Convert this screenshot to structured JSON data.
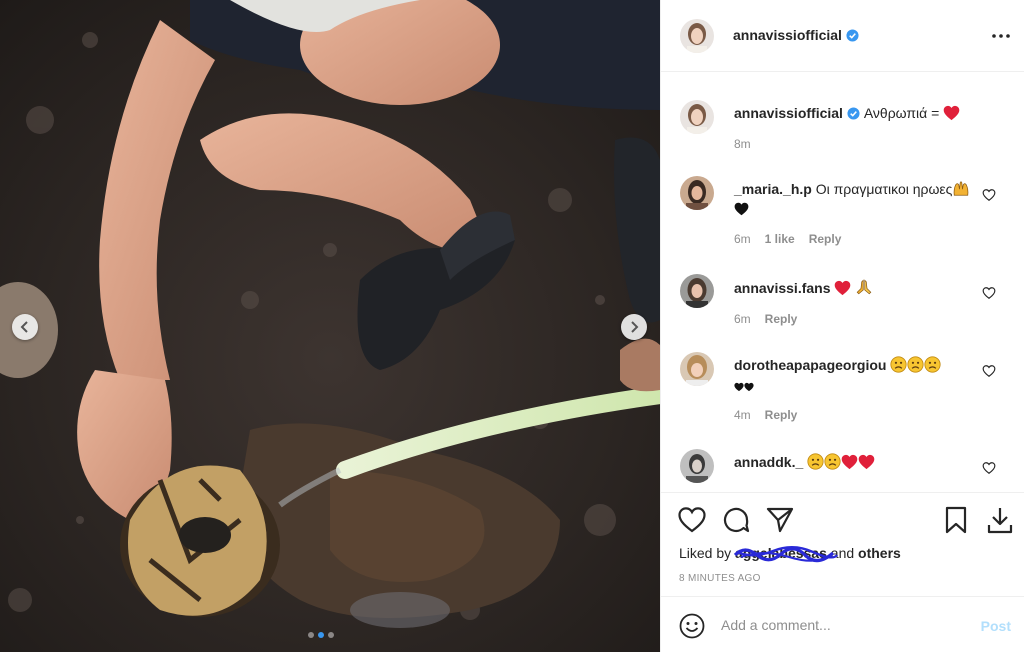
{
  "post": {
    "author": "annavissiofficial",
    "verified": true,
    "more_icon": "more-horizontal-icon"
  },
  "caption": {
    "username": "annavissiofficial",
    "text": "Ανθρωπιά = ",
    "emoji": "red-heart",
    "time": "8m"
  },
  "comments": [
    {
      "username": "_maria._h.p",
      "text": "Οι πραγματικοι ηρωες",
      "emojis": [
        "hands-icon",
        "black-heart"
      ],
      "time": "6m",
      "likes": "1 like",
      "reply": "Reply"
    },
    {
      "username": "annavissi.fans",
      "text": "",
      "emojis": [
        "red-heart",
        "folded-hands"
      ],
      "time": "6m",
      "likes": "",
      "reply": "Reply"
    },
    {
      "username": "dorotheapapageorgiou",
      "text": "",
      "emojis": [
        "sad-face",
        "sad-face",
        "sad-face",
        "black-heart",
        "black-heart"
      ],
      "time": "4m",
      "likes": "",
      "reply": "Reply"
    },
    {
      "username": "annaddk._",
      "text": "",
      "emojis": [
        "sad-face",
        "sad-face",
        "red-heart",
        "red-heart"
      ],
      "time": "",
      "likes": "",
      "reply": ""
    }
  ],
  "actions": {
    "liked_prefix": "Liked by ",
    "liked_user": "aggelabessas",
    "liked_and": " and ",
    "liked_others": "others",
    "timeago": "8 MINUTES AGO"
  },
  "add_comment": {
    "placeholder": "Add a comment...",
    "post_label": "Post"
  },
  "carousel": {
    "slides": 3,
    "active": 1
  },
  "colors": {
    "verified_blue": "#3897f0",
    "heart_red": "#ed4956",
    "post_button_disabled": "#b2dffc",
    "meta_gray": "#8e8e8e"
  }
}
